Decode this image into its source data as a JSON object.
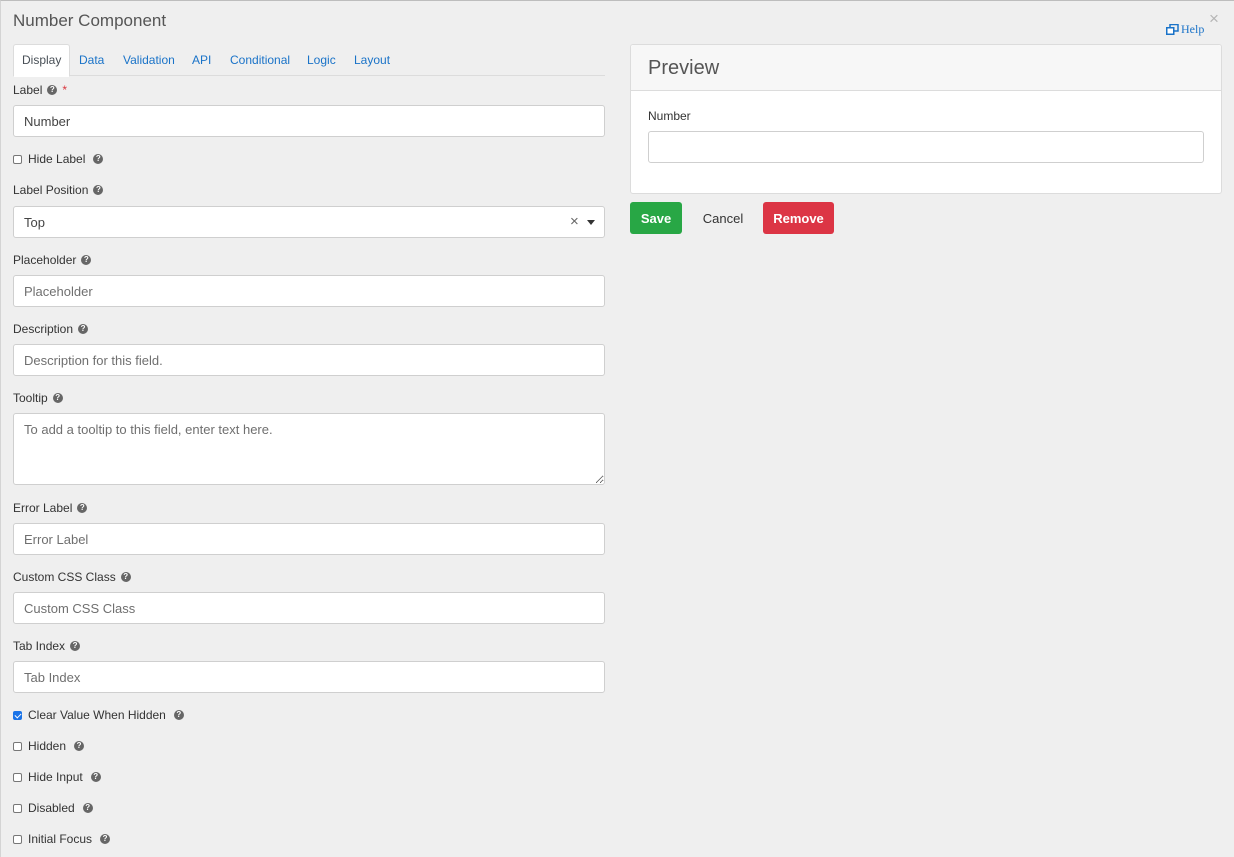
{
  "dialog": {
    "title": "Number Component",
    "close_glyph": "×",
    "help_label": "Help"
  },
  "tabs": [
    {
      "label": "Display",
      "active": true
    },
    {
      "label": "Data",
      "active": false
    },
    {
      "label": "Validation",
      "active": false
    },
    {
      "label": "API",
      "active": false
    },
    {
      "label": "Conditional",
      "active": false
    },
    {
      "label": "Logic",
      "active": false
    },
    {
      "label": "Layout",
      "active": false
    }
  ],
  "form": {
    "label": {
      "label": "Label",
      "required_mark": "*",
      "value": "Number"
    },
    "hide_label": {
      "label": "Hide Label",
      "checked": false
    },
    "label_position": {
      "label": "Label Position",
      "value": "Top",
      "clear_glyph": "×"
    },
    "placeholder": {
      "label": "Placeholder",
      "placeholder": "Placeholder"
    },
    "description": {
      "label": "Description",
      "placeholder": "Description for this field."
    },
    "tooltip": {
      "label": "Tooltip",
      "placeholder": "To add a tooltip to this field, enter text here."
    },
    "error_label": {
      "label": "Error Label",
      "placeholder": "Error Label"
    },
    "custom_css": {
      "label": "Custom CSS Class",
      "placeholder": "Custom CSS Class"
    },
    "tab_index": {
      "label": "Tab Index",
      "placeholder": "Tab Index"
    },
    "clear_value_when_hidden": {
      "label": "Clear Value When Hidden",
      "checked": true
    },
    "hidden": {
      "label": "Hidden",
      "checked": false
    },
    "hide_input": {
      "label": "Hide Input",
      "checked": false
    },
    "disabled": {
      "label": "Disabled",
      "checked": false
    },
    "initial_focus": {
      "label": "Initial Focus",
      "checked": false
    }
  },
  "help_icon_glyph": "?",
  "preview": {
    "title": "Preview",
    "field_label": "Number",
    "field_value": ""
  },
  "buttons": {
    "save": "Save",
    "cancel": "Cancel",
    "remove": "Remove"
  },
  "colors": {
    "link": "#1a73c8",
    "save": "#28a745",
    "remove": "#dc3545",
    "checkbox_checked": "#1a73e8"
  }
}
